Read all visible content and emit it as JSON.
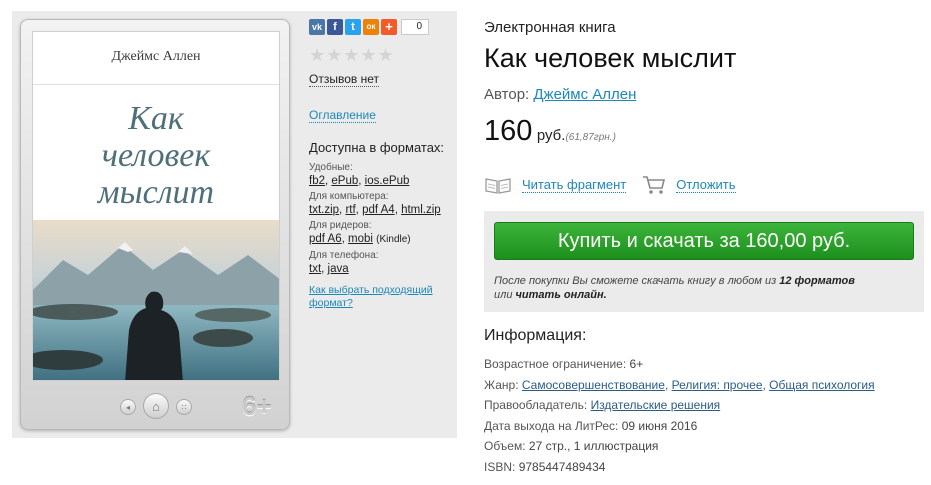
{
  "cover": {
    "author": "Джеймс Аллен",
    "title_lines": [
      "Как",
      "человек",
      "мыслит"
    ]
  },
  "reader": {
    "age_badge": "6+"
  },
  "share": {
    "buttons": [
      {
        "icon": "vk-icon",
        "glyph": "vk",
        "color": "#4a76a8"
      },
      {
        "icon": "facebook-icon",
        "glyph": "f",
        "color": "#3b5998"
      },
      {
        "icon": "twitter-icon",
        "glyph": "t",
        "color": "#2aa3ef"
      },
      {
        "icon": "odnoklassniki-icon",
        "glyph": "ок",
        "color": "#ee8208"
      },
      {
        "icon": "plus-share-icon",
        "glyph": "+",
        "color": "#f25a2b"
      }
    ],
    "count": "0"
  },
  "rating": {
    "stars": "★★★★★",
    "stars_filled": 0,
    "reviews": "Отзывов нет"
  },
  "toc_link": "Оглавление",
  "formats": {
    "heading": "Доступна в форматах:",
    "groups": [
      {
        "category": "Удобные:",
        "items": [
          "fb2",
          "ePub",
          "ios.ePub"
        ]
      },
      {
        "category": "Для компьютера:",
        "items": [
          "txt.zip",
          "rtf",
          "pdf A4",
          "html.zip"
        ]
      },
      {
        "category": "Для ридеров:",
        "items": [
          "pdf A6",
          "mobi"
        ],
        "note": "(Kindle)"
      },
      {
        "category": "Для телефона:",
        "items": [
          "txt",
          "java"
        ]
      }
    ],
    "howto_link": "Как выбрать подходящий формат?"
  },
  "book": {
    "type": "Электронная книга",
    "title": "Как человек мыслит",
    "author_label": "Автор:",
    "author": "Джеймс Аллен",
    "price": "160",
    "currency": "руб.",
    "alt_price": "(61,87грн.)"
  },
  "actions": {
    "read_fragment": "Читать фрагмент",
    "postpone": "Отложить"
  },
  "buy": {
    "button_label": "Купить и скачать за 160,00 руб.",
    "note_part1": "После покупки Вы сможете скачать книгу в любом из",
    "note_bold1": "12 форматов",
    "note_part2": "или",
    "note_bold2": "читать онлайн."
  },
  "info": {
    "title": "Информация:",
    "age_label": "Возрастное ограничение:",
    "age_value": "6+",
    "genre_label": "Жанр:",
    "genres": [
      "Самосовершенствование",
      "Религия: прочее",
      "Общая психология"
    ],
    "rights_label": "Правообладатель:",
    "rights_value": "Издательские решения",
    "release_label": "Дата выхода на ЛитРес:",
    "release_value": "09 июня 2016",
    "volume_label": "Объем:",
    "volume_value": "27 стр., 1 иллюстрация",
    "isbn_label": "ISBN:",
    "isbn_value": "9785447489434"
  },
  "colors": {
    "link": "#1c88b8",
    "buy_green": "#2aa32a",
    "panel_grey": "#ebebeb"
  }
}
